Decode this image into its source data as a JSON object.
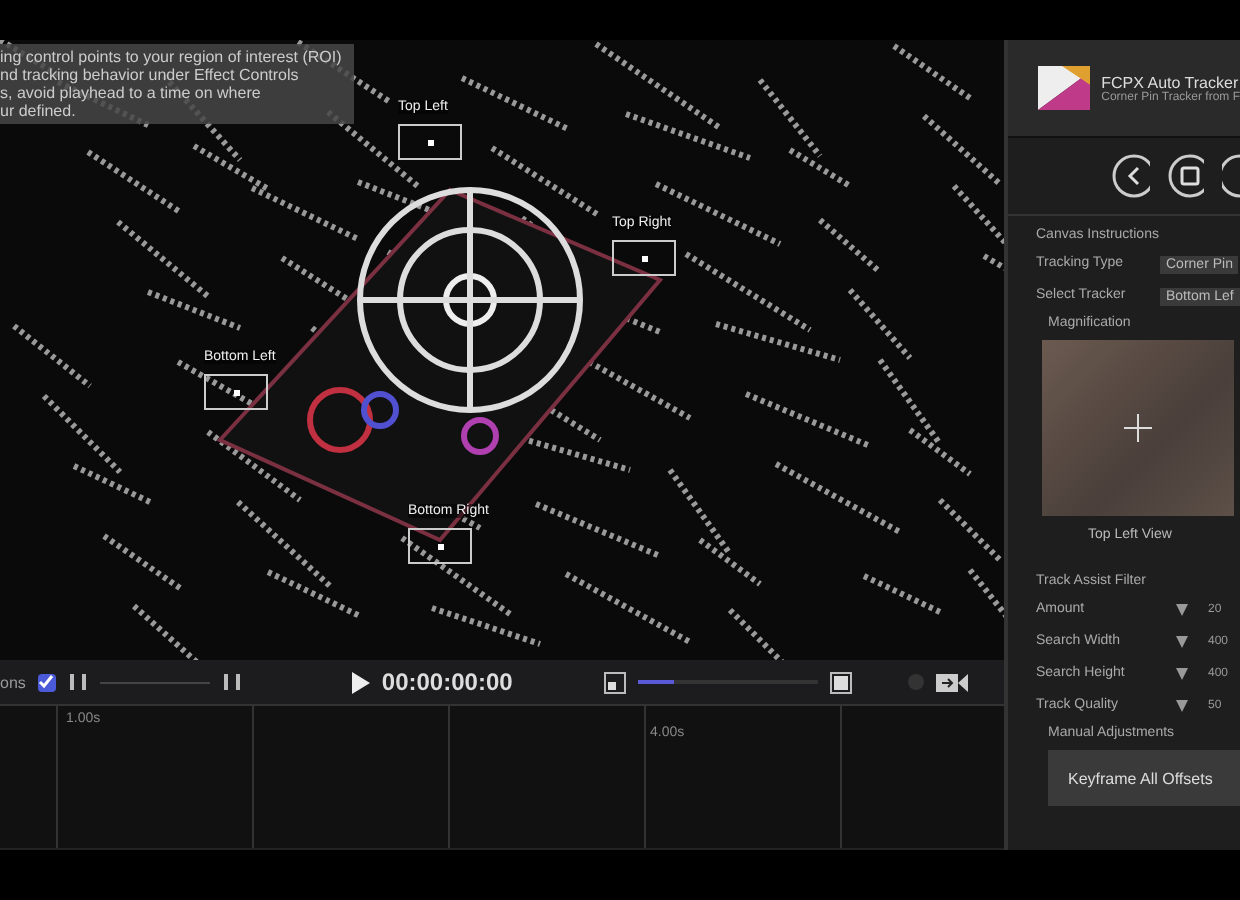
{
  "video": {
    "instructions": [
      "ing control points to your region of interest (ROI)",
      "nd tracking behavior under Effect Controls",
      "s, avoid playhead to a time on where",
      "ur defined."
    ],
    "pins": [
      {
        "label": "Top Left"
      },
      {
        "label": "Top Right"
      },
      {
        "label": "Bottom Left"
      },
      {
        "label": "Bottom Right"
      }
    ]
  },
  "controls": {
    "label": "ons",
    "checked": true,
    "timecode": "00:00:00:00",
    "zoom": {
      "level": 0.2
    }
  },
  "timeline": {
    "ticks": [
      "1.00s",
      "4.00s"
    ]
  },
  "panel": {
    "title": "FCPX Auto Tracker",
    "subtitle": "Corner Pin Tracker from F",
    "section": "Canvas Instructions",
    "fields": [
      {
        "label": "Tracking Type",
        "value": "Corner Pin"
      },
      {
        "label": "Select Tracker",
        "value": "Bottom Lef"
      }
    ],
    "magnification": "Magnification",
    "view_caption": "Top Left View",
    "filter_title": "Track Assist Filter",
    "sliders": [
      {
        "label": "Amount",
        "value": "20"
      },
      {
        "label": "Search Width",
        "value": "400"
      },
      {
        "label": "Search Height",
        "value": "400"
      },
      {
        "label": "Track Quality",
        "value": "50"
      }
    ],
    "manual": "Manual Adjustments",
    "button": "Keyframe All Offsets"
  }
}
